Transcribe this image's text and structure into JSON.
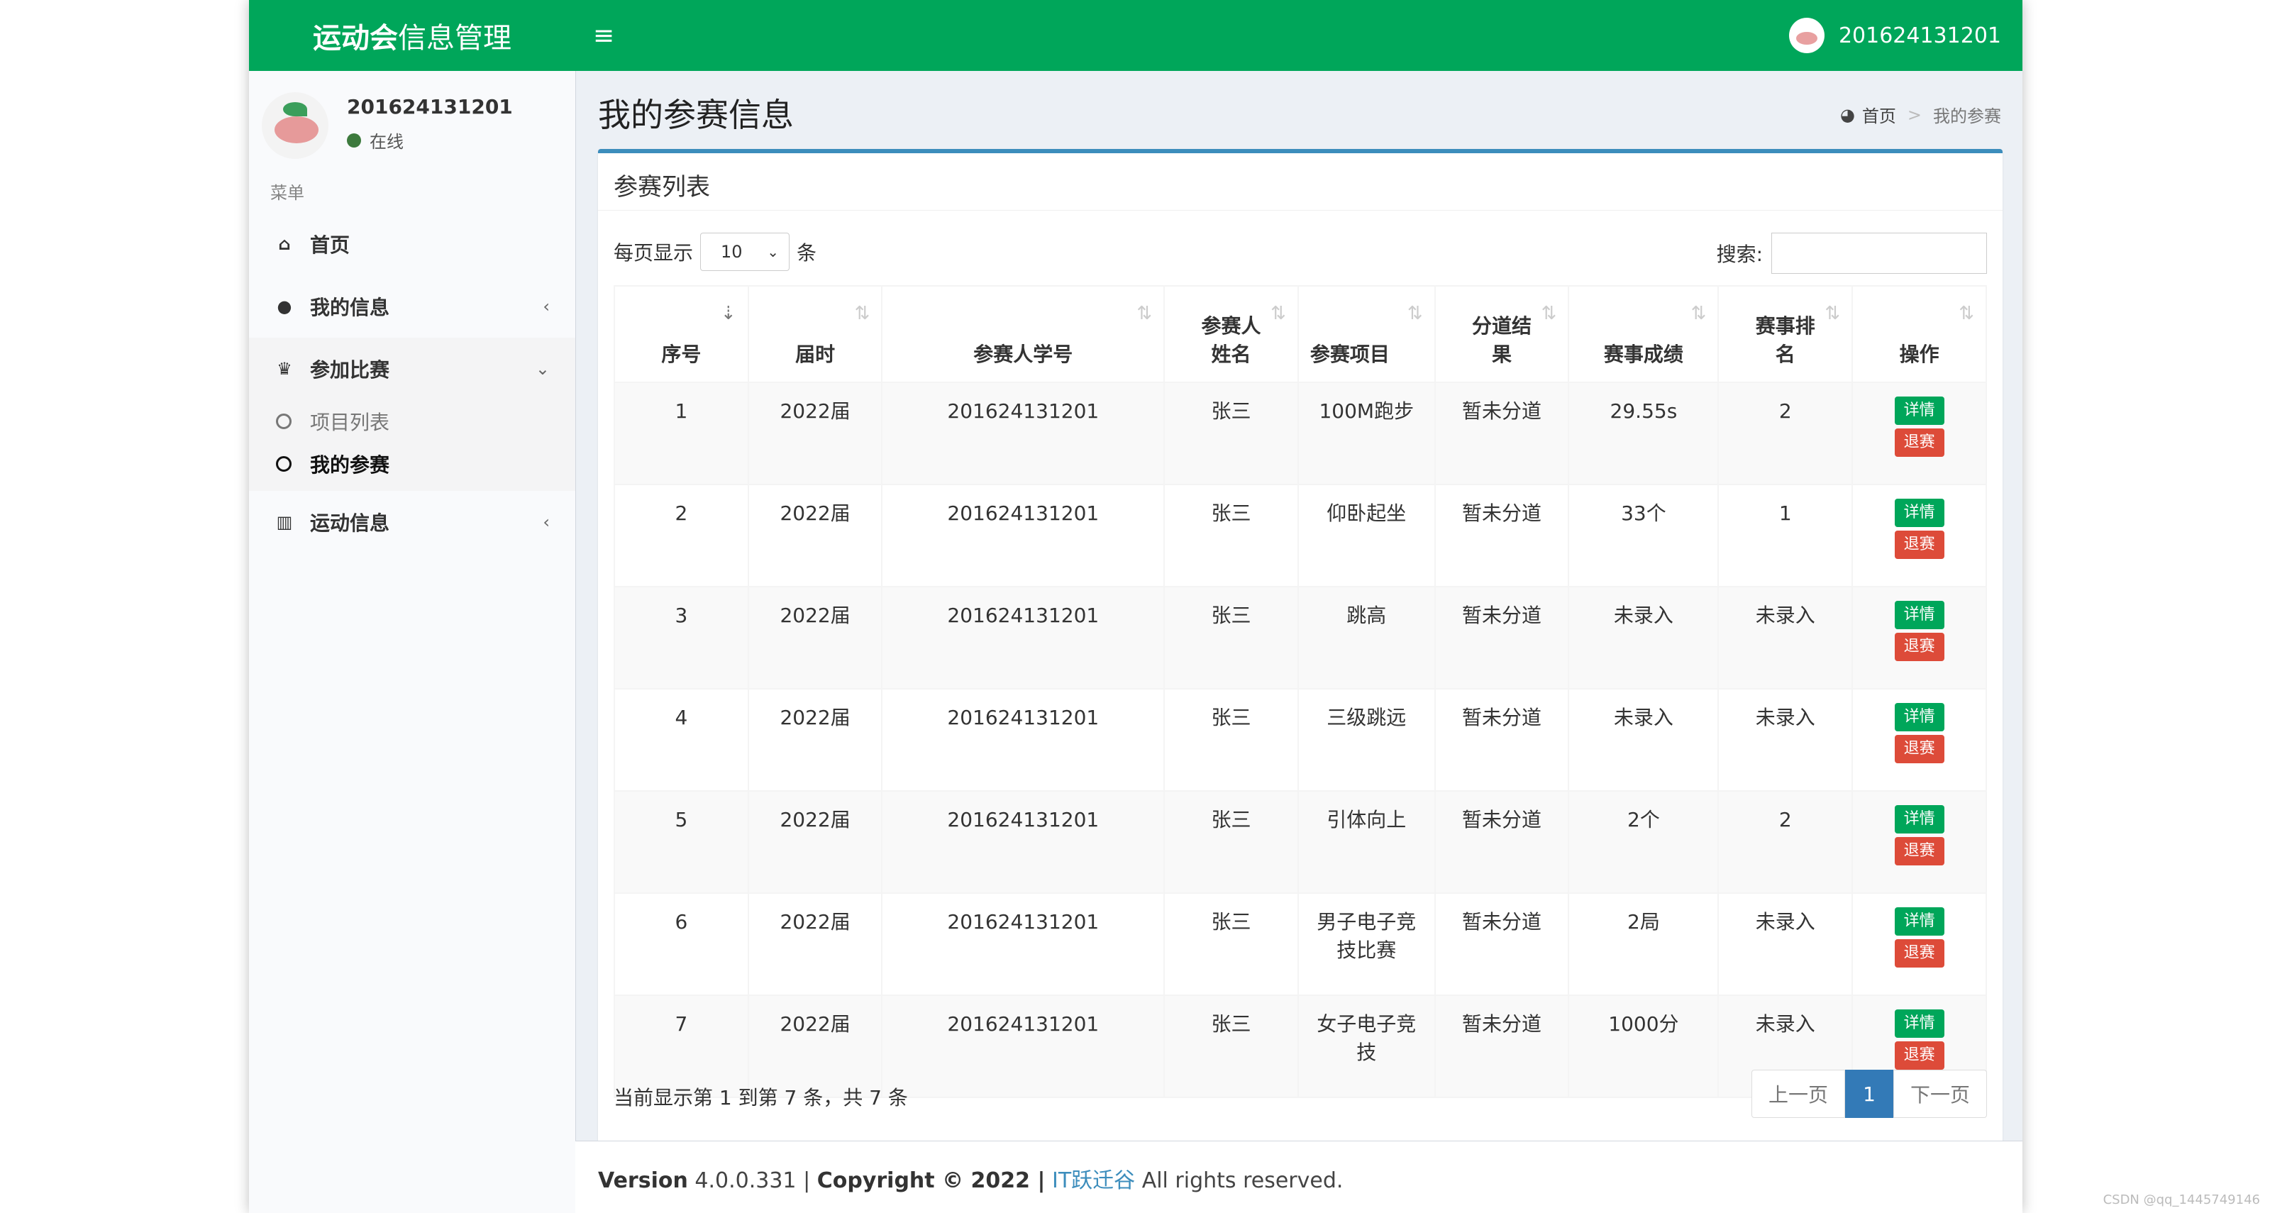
{
  "header": {
    "logo_bold": "运动会",
    "logo_rest": "信息管理",
    "toggle_icon": "hamburger-icon",
    "username": "201624131201"
  },
  "sidebar": {
    "user_name": "201624131201",
    "user_status": "在线",
    "menu_header": "菜单",
    "items": [
      {
        "label": "首页",
        "icon": "home-icon"
      },
      {
        "label": "我的信息",
        "icon": "user-icon"
      },
      {
        "label": "参加比赛",
        "icon": "trophy-icon"
      },
      {
        "label": "运动信息",
        "icon": "bar-chart-icon"
      }
    ],
    "sub_items": [
      {
        "label": "项目列表"
      },
      {
        "label": "我的参赛"
      }
    ]
  },
  "content": {
    "title": "我的参赛信息",
    "breadcrumb": {
      "home": "首页",
      "current": "我的参赛"
    },
    "box_title": "参赛列表",
    "length_prefix": "每页显示",
    "length_value": "10",
    "length_suffix": "条",
    "search_label": "搜索:",
    "columns": [
      {
        "line1": "序号",
        "line2": ""
      },
      {
        "line1": "届时",
        "line2": ""
      },
      {
        "line1": "参赛人学号",
        "line2": ""
      },
      {
        "line1": "参赛人",
        "line2": "姓名"
      },
      {
        "line1": "参赛项目",
        "line2": ""
      },
      {
        "line1": "分道结",
        "line2": "果"
      },
      {
        "line1": "赛事成绩",
        "line2": ""
      },
      {
        "line1": "赛事排",
        "line2": "名"
      },
      {
        "line1": "操作",
        "line2": ""
      }
    ],
    "rows": [
      {
        "no": "1",
        "session": "2022届",
        "sid": "201624131201",
        "name": "张三",
        "event": "100M跑步",
        "event2": "",
        "lane": "暂未分道",
        "score": "29.55s",
        "rank": "2"
      },
      {
        "no": "2",
        "session": "2022届",
        "sid": "201624131201",
        "name": "张三",
        "event": "仰卧起坐",
        "event2": "",
        "lane": "暂未分道",
        "score": "33个",
        "rank": "1"
      },
      {
        "no": "3",
        "session": "2022届",
        "sid": "201624131201",
        "name": "张三",
        "event": "跳高",
        "event2": "",
        "lane": "暂未分道",
        "score": "未录入",
        "rank": "未录入"
      },
      {
        "no": "4",
        "session": "2022届",
        "sid": "201624131201",
        "name": "张三",
        "event": "三级跳远",
        "event2": "",
        "lane": "暂未分道",
        "score": "未录入",
        "rank": "未录入"
      },
      {
        "no": "5",
        "session": "2022届",
        "sid": "201624131201",
        "name": "张三",
        "event": "引体向上",
        "event2": "",
        "lane": "暂未分道",
        "score": "2个",
        "rank": "2"
      },
      {
        "no": "6",
        "session": "2022届",
        "sid": "201624131201",
        "name": "张三",
        "event": "男子电子竞",
        "event2": "技比赛",
        "lane": "暂未分道",
        "score": "2局",
        "rank": "未录入"
      },
      {
        "no": "7",
        "session": "2022届",
        "sid": "201624131201",
        "name": "张三",
        "event": "女子电子竞",
        "event2": "技",
        "lane": "暂未分道",
        "score": "1000分",
        "rank": "未录入"
      }
    ],
    "btn_detail": "详情",
    "btn_quit": "退赛",
    "info": "当前显示第 1 到第 7 条，共 7 条",
    "pager": {
      "prev": "上一页",
      "current": "1",
      "next": "下一页"
    }
  },
  "footer": {
    "version_label": "Version",
    "version": "4.0.0.331",
    "copyright": "Copyright © 2022 |",
    "link": "IT跃迁谷",
    "rights": "All rights reserved."
  },
  "watermark": "CSDN @qq_1445749146",
  "colors": {
    "header": "#00a65a",
    "primary": "#3c8dbc",
    "danger": "#dd4b39",
    "success": "#00a65a"
  }
}
